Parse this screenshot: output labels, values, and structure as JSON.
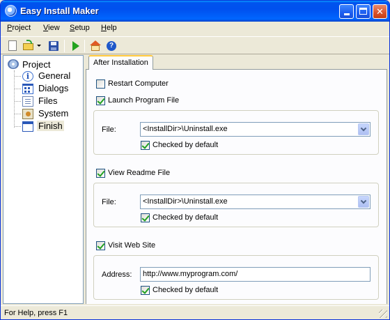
{
  "window": {
    "title": "Easy Install Maker",
    "controls": {
      "minimize": "minimize",
      "maximize": "maximize",
      "close": "✕"
    }
  },
  "menu": {
    "items": [
      "Project",
      "View",
      "Setup",
      "Help"
    ]
  },
  "toolbar": {
    "icons": [
      "new-icon",
      "open-icon",
      "save-icon",
      "run-icon",
      "home-icon",
      "help-icon"
    ],
    "help_glyph": "?"
  },
  "tree": {
    "root": "Project",
    "items": [
      {
        "label": "General",
        "icon": "info-icon"
      },
      {
        "label": "Dialogs",
        "icon": "dialogs-icon"
      },
      {
        "label": "Files",
        "icon": "files-icon"
      },
      {
        "label": "System",
        "icon": "system-icon"
      },
      {
        "label": "Finish",
        "icon": "finish-icon"
      }
    ],
    "selected": "Finish",
    "info_glyph": "i"
  },
  "tab": {
    "label": "After Installation"
  },
  "form": {
    "restart": {
      "label": "Restart Computer",
      "checked": false
    },
    "launch": {
      "label": "Launch Program File",
      "checked": true,
      "file_label": "File:",
      "file_value": "<InstallDir>\\Uninstall.exe",
      "default_label": "Checked by default",
      "default_checked": true
    },
    "readme": {
      "label": "View Readme File",
      "checked": true,
      "file_label": "File:",
      "file_value": "<InstallDir>\\Uninstall.exe",
      "default_label": "Checked by default",
      "default_checked": true
    },
    "website": {
      "label": "Visit Web Site",
      "checked": true,
      "address_label": "Address:",
      "address_value": "http://www.myprogram.com/",
      "default_label": "Checked by default",
      "default_checked": true
    }
  },
  "status": {
    "text": "For Help, press F1"
  },
  "colors": {
    "titlebar": "#0053ee",
    "tab_accent": "#ffc83c",
    "check": "#21a121",
    "face": "#ece9d8"
  }
}
